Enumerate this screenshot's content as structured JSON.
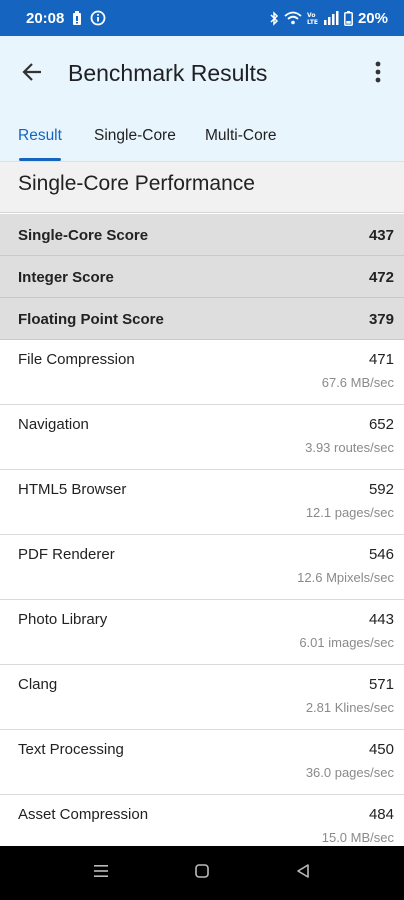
{
  "status_bar": {
    "time": "20:08",
    "battery_percent": "20%",
    "icons": [
      "battery-saver-icon",
      "info-icon",
      "bluetooth-icon",
      "wifi-icon",
      "volte-icon",
      "signal-icon",
      "battery-icon"
    ]
  },
  "header": {
    "title": "Benchmark Results",
    "back_icon": "arrow-back-icon",
    "menu_icon": "more-vert-icon"
  },
  "tabs": [
    {
      "label": "Result",
      "active": true
    },
    {
      "label": "Single-Core",
      "active": false
    },
    {
      "label": "Multi-Core",
      "active": false
    }
  ],
  "section": {
    "title": "Single-Core Performance"
  },
  "scores": [
    {
      "label": "Single-Core Score",
      "value": "437"
    },
    {
      "label": "Integer Score",
      "value": "472"
    },
    {
      "label": "Floating Point Score",
      "value": "379"
    }
  ],
  "tests": [
    {
      "name": "File Compression",
      "score": "471",
      "rate": "67.6 MB/sec"
    },
    {
      "name": "Navigation",
      "score": "652",
      "rate": "3.93 routes/sec"
    },
    {
      "name": "HTML5 Browser",
      "score": "592",
      "rate": "12.1 pages/sec"
    },
    {
      "name": "PDF Renderer",
      "score": "546",
      "rate": "12.6 Mpixels/sec"
    },
    {
      "name": "Photo Library",
      "score": "443",
      "rate": "6.01 images/sec"
    },
    {
      "name": "Clang",
      "score": "571",
      "rate": "2.81 Klines/sec"
    },
    {
      "name": "Text Processing",
      "score": "450",
      "rate": "36.0 pages/sec"
    },
    {
      "name": "Asset Compression",
      "score": "484",
      "rate": "15.0 MB/sec"
    }
  ],
  "nav_bar": {
    "icons": [
      "recents-icon",
      "home-icon",
      "back-icon"
    ]
  },
  "colors": {
    "accent": "#1565c0",
    "header_bg": "#e8f5fd",
    "score_row_bg": "#dedede"
  }
}
